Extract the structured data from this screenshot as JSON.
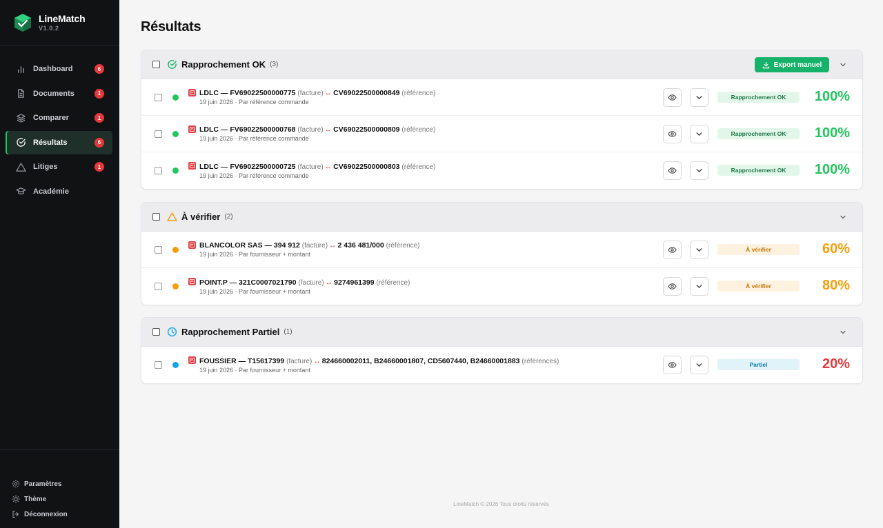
{
  "brand": {
    "name": "LineMatch",
    "version": "V1.0.2"
  },
  "nav": [
    {
      "label": "Dashboard",
      "badge": "6",
      "icon": "bar-chart-icon"
    },
    {
      "label": "Documents",
      "badge": "1",
      "icon": "document-icon"
    },
    {
      "label": "Comparer",
      "badge": "1",
      "icon": "layers-icon"
    },
    {
      "label": "Résultats",
      "badge": "6",
      "icon": "check-circle-icon",
      "active": true
    },
    {
      "label": "Litiges",
      "badge": "1",
      "icon": "warning-icon"
    },
    {
      "label": "Académie",
      "badge": "",
      "icon": "graduation-cap-icon"
    }
  ],
  "bottom_nav": {
    "settings": "Paramètres",
    "theme": "Thème",
    "logout": "Déconnexion"
  },
  "page_title": "Résultats",
  "groups": [
    {
      "title": "Rapprochement OK",
      "count": "(3)",
      "icon": "check-circle-icon",
      "icon_color": "#17b26a",
      "export_label": "Export manuel",
      "rows": [
        {
          "vendor": "LDLC — FV69022500000775",
          "left_type": "(facture)",
          "right": "CV69022500000849",
          "right_type": "(référence)",
          "meta": "19 juin 2026 · Par référence commande",
          "dot_color": "#22c55e",
          "status": "Rapprochement OK",
          "status_bg": "#e3f6ea",
          "status_color": "#1b7a45",
          "score": "100%",
          "score_color": "#22c55e"
        },
        {
          "vendor": "LDLC — FV69022500000768",
          "left_type": "(facture)",
          "right": "CV69022500000809",
          "right_type": "(référence)",
          "meta": "19 juin 2026 · Par référence commande",
          "dot_color": "#22c55e",
          "status": "Rapprochement OK",
          "status_bg": "#e3f6ea",
          "status_color": "#1b7a45",
          "score": "100%",
          "score_color": "#22c55e"
        },
        {
          "vendor": "LDLC — FV69022500000725",
          "left_type": "(facture)",
          "right": "CV69022500000803",
          "right_type": "(référence)",
          "meta": "19 juin 2026 · Par référence commande",
          "dot_color": "#22c55e",
          "status": "Rapprochement OK",
          "status_bg": "#e3f6ea",
          "status_color": "#1b7a45",
          "score": "100%",
          "score_color": "#22c55e"
        }
      ]
    },
    {
      "title": "À vérifier",
      "count": "(2)",
      "icon": "warning-icon",
      "icon_color": "#f59e0b",
      "export_label": "",
      "rows": [
        {
          "vendor": "BLANCOLOR SAS — 394 912",
          "left_type": "(facture)",
          "right": "2 436 481/000",
          "right_type": "(référence)",
          "meta": "19 juin 2026 · Par fournisseur + montant",
          "dot_color": "#f59e0b",
          "status": "À vérifier",
          "status_bg": "#fdf1e0",
          "status_color": "#c57a0a",
          "score": "60%",
          "score_color": "#f59e0b"
        },
        {
          "vendor": "POINT.P — 321C0007021790",
          "left_type": "(facture)",
          "right": "9274961399",
          "right_type": "(référence)",
          "meta": "19 juin 2026 · Par fournisseur + montant",
          "dot_color": "#f59e0b",
          "status": "À vérifier",
          "status_bg": "#fdf1e0",
          "status_color": "#c57a0a",
          "score": "80%",
          "score_color": "#f59e0b"
        }
      ]
    },
    {
      "title": "Rapprochement Partiel",
      "count": "(1)",
      "icon": "clock-icon",
      "icon_color": "#0ea5e9",
      "export_label": "",
      "rows": [
        {
          "vendor": "FOUSSIER — T15617399",
          "left_type": "(facture)",
          "right": "824660002011, B24660001807, CD5607440, B24660001883",
          "right_type": "(références)",
          "meta": "19 juin 2026 · Par fournisseur + montant",
          "dot_color": "#0ea5e9",
          "status": "Partiel",
          "status_bg": "#e0f3f9",
          "status_color": "#0b7aa8",
          "score": "20%",
          "score_color": "#e5383b"
        }
      ]
    }
  ],
  "arrow_symbol": "↔",
  "footer": "LineMatch © 2026 Tous droits réservés"
}
